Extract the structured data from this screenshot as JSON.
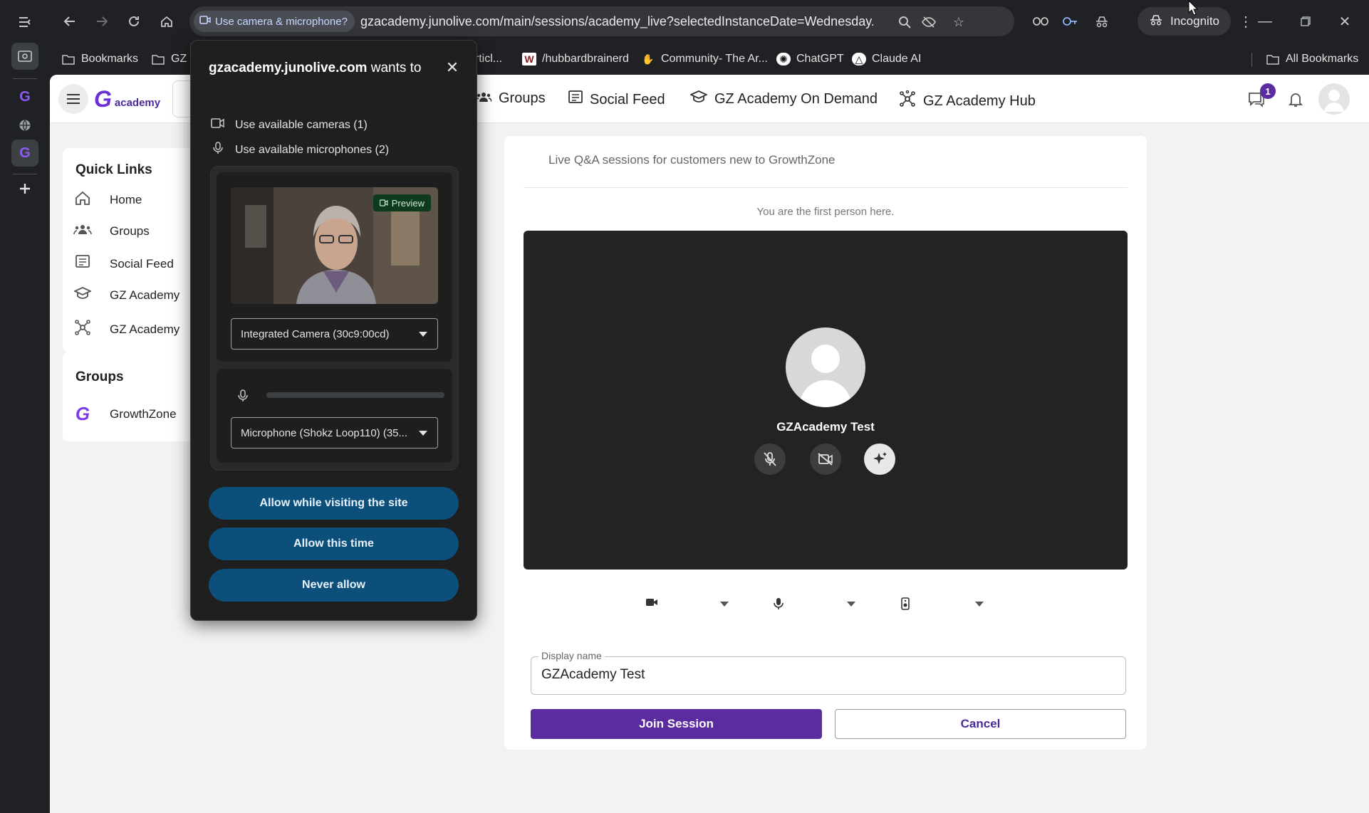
{
  "browser": {
    "site_chip": "Use camera & microphone?",
    "url": "gzacademy.junolive.com/main/sessions/academy_live?selectedInstanceDate=Wednesday...",
    "incognito_label": "Incognito"
  },
  "bookmarks": {
    "items": [
      {
        "label": "Bookmarks",
        "icon": "folder-icon"
      },
      {
        "label": "GZ",
        "icon": "folder-icon"
      },
      {
        "label": "articl...",
        "icon": "page-icon"
      },
      {
        "label": "/hubbardbrainerd",
        "icon": "w-icon"
      },
      {
        "label": "Community- The Ar...",
        "icon": "hand-icon"
      },
      {
        "label": "ChatGPT",
        "icon": "chatgpt-icon"
      },
      {
        "label": "Claude AI",
        "icon": "claude-icon"
      }
    ],
    "all_bookmarks": "All Bookmarks"
  },
  "header": {
    "logo_mark": "G",
    "logo_text": "academy",
    "nav": [
      {
        "label": "Groups",
        "icon": "groups-icon"
      },
      {
        "label": "Social Feed",
        "icon": "feed-icon"
      },
      {
        "label": "GZ Academy On Demand",
        "icon": "graduation-cap-icon"
      },
      {
        "label": "GZ Academy Hub",
        "icon": "hub-icon"
      }
    ],
    "messages_badge": "1"
  },
  "quick_links": {
    "title": "Quick Links",
    "items": [
      {
        "label": "Home",
        "icon": "home-icon"
      },
      {
        "label": "Groups",
        "icon": "groups-icon"
      },
      {
        "label": "Social Feed",
        "icon": "feed-icon"
      },
      {
        "label": "GZ Academy",
        "icon": "graduation-cap-icon"
      },
      {
        "label": "GZ Academy",
        "icon": "hub-icon"
      }
    ]
  },
  "groups": {
    "title": "Groups",
    "items": [
      {
        "label": "GrowthZone"
      }
    ]
  },
  "session": {
    "subtitle": "Live Q&A sessions for customers new to GrowthZone",
    "status": "You are the first person here.",
    "participant_name": "GZAcademy Test",
    "display_name_label": "Display name",
    "display_name_value": "GZAcademy Test",
    "join_label": "Join Session",
    "cancel_label": "Cancel"
  },
  "permission_popup": {
    "site": "gzacademy.junolive.com",
    "wants_to": "wants to",
    "cameras_line": "Use available cameras (1)",
    "microphones_line": "Use available microphones (2)",
    "preview_label": "Preview",
    "camera_select": "Integrated Camera (30c9:00cd)",
    "microphone_select": "Microphone (Shokz Loop110) (35...",
    "allow_visiting": "Allow while visiting the site",
    "allow_once": "Allow this time",
    "never_allow": "Never allow"
  },
  "colors": {
    "brand_purple": "#5b2ca0",
    "popup_button": "#0b4f7a",
    "video_bg": "#232323"
  }
}
